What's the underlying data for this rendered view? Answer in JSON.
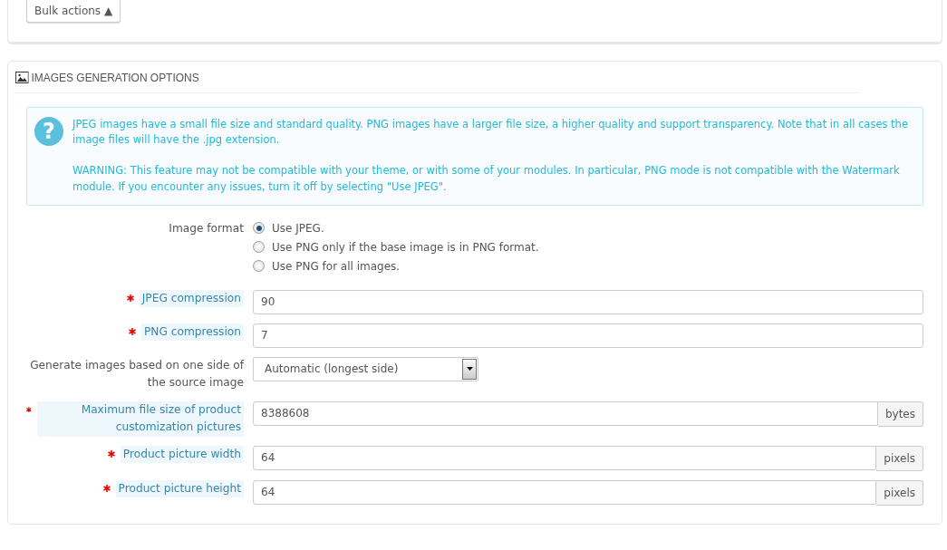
{
  "bulk_actions": {
    "label": "Bulk actions",
    "caret": "▲"
  },
  "panel": {
    "title": "IMAGES GENERATION OPTIONS",
    "alert": {
      "icon": "?",
      "paragraphs": [
        "JPEG images have a small file size and standard quality. PNG images have a larger file size, a higher quality and support transparency. Note that in all cases the image files will have the .jpg extension.",
        "WARNING: This feature may not be compatible with your theme, or with some of your modules. In particular, PNG mode is not compatible with the Watermark module. If you encounter any issues, turn it off by selecting \"Use JPEG\"."
      ]
    },
    "fields": [
      {
        "kind": "radio",
        "label": "Image format",
        "required": false,
        "options": [
          {
            "label": "Use JPEG.",
            "selected": true
          },
          {
            "label": "Use PNG only if the base image is in PNG format.",
            "selected": false
          },
          {
            "label": "Use PNG for all images.",
            "selected": false
          }
        ]
      },
      {
        "kind": "text",
        "label": "JPEG compression",
        "required": true,
        "value": "90"
      },
      {
        "kind": "text",
        "label": "PNG compression",
        "required": true,
        "value": "7"
      },
      {
        "kind": "select",
        "label": "Generate images based on one side of the source image",
        "required": false,
        "value": "Automatic (longest side)"
      },
      {
        "kind": "addon",
        "label": "Maximum file size of product customization pictures",
        "required": true,
        "value": "8388608",
        "suffix": "bytes"
      },
      {
        "kind": "addon",
        "label": "Product picture width",
        "required": true,
        "value": "64",
        "suffix": "pixels"
      },
      {
        "kind": "addon",
        "label": "Product picture height",
        "required": true,
        "value": "64",
        "suffix": "pixels"
      }
    ]
  }
}
